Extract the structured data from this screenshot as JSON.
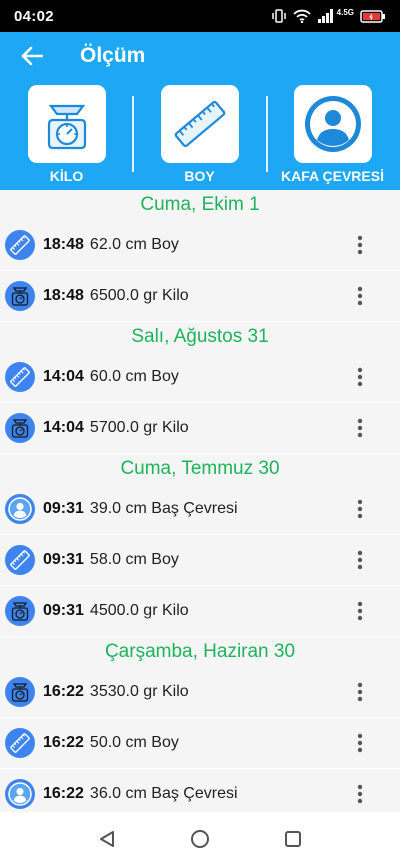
{
  "status_bar": {
    "time": "04:02",
    "network": "4.5G"
  },
  "app_bar": {
    "title": "Ölçüm"
  },
  "categories": [
    {
      "label": "KİLO",
      "icon": "scale-icon"
    },
    {
      "label": "BOY",
      "icon": "ruler-icon"
    },
    {
      "label": "KAFA ÇEVRESİ",
      "icon": "head-person-icon"
    }
  ],
  "groups": [
    {
      "date": "Cuma, Ekim 1",
      "entries": [
        {
          "time": "18:48",
          "value": "62.0 cm Boy",
          "icon": "ruler-icon"
        },
        {
          "time": "18:48",
          "value": "6500.0 gr Kilo",
          "icon": "scale-icon"
        }
      ]
    },
    {
      "date": "Salı, Ağustos 31",
      "entries": [
        {
          "time": "14:04",
          "value": "60.0 cm Boy",
          "icon": "ruler-icon"
        },
        {
          "time": "14:04",
          "value": "5700.0 gr Kilo",
          "icon": "scale-icon"
        }
      ]
    },
    {
      "date": "Cuma, Temmuz 30",
      "entries": [
        {
          "time": "09:31",
          "value": "39.0 cm Baş Çevresi",
          "icon": "head-person-icon"
        },
        {
          "time": "09:31",
          "value": "58.0 cm Boy",
          "icon": "ruler-icon"
        },
        {
          "time": "09:31",
          "value": "4500.0 gr Kilo",
          "icon": "scale-icon"
        }
      ]
    },
    {
      "date": "Çarşamba, Haziran 30",
      "entries": [
        {
          "time": "16:22",
          "value": "3530.0 gr Kilo",
          "icon": "scale-icon"
        },
        {
          "time": "16:22",
          "value": "50.0 cm Boy",
          "icon": "ruler-icon"
        },
        {
          "time": "16:22",
          "value": "36.0 cm Baş Çevresi",
          "icon": "head-person-icon"
        }
      ]
    }
  ],
  "colors": {
    "primary": "#1ea7f4",
    "date_header": "#1fb35c",
    "row_icon_bg": "#3d84f0"
  }
}
